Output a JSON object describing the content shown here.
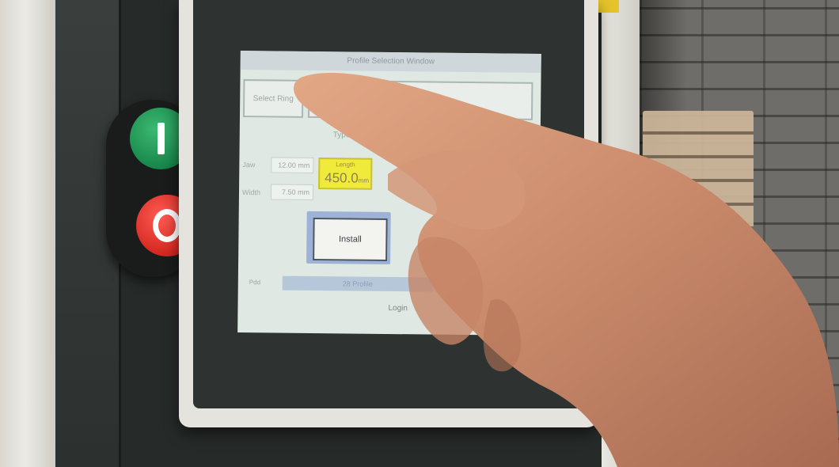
{
  "scene": {
    "description_free": true
  },
  "push_buttons": {
    "start_icon": "power-on-icon",
    "stop_icon": "power-off-icon",
    "start_color": "#1f9b58",
    "stop_color": "#e02a22"
  },
  "hmi": {
    "window_title": "Profile Selection Window",
    "tabs": [
      "Select Ring",
      ""
    ],
    "type_label": "Type",
    "fields": [
      {
        "label": "Jaw",
        "value": "12.00 mm"
      },
      {
        "label": "Width",
        "value": "7.50 mm"
      }
    ],
    "length": {
      "label": "Length",
      "value": "450.0",
      "unit": "mm",
      "color": "#f0ea3a"
    },
    "install_button": "Install",
    "status_left": "Pdd",
    "status_strip": "28 Profile",
    "login_button": "Login"
  }
}
